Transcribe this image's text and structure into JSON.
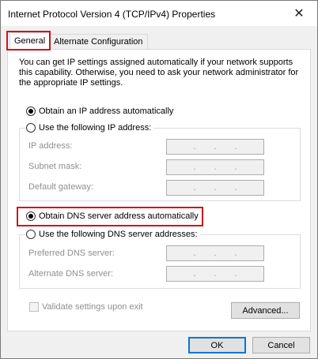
{
  "window": {
    "title": "Internet Protocol Version 4 (TCP/IPv4) Properties",
    "close_glyph": "✕"
  },
  "tabs": [
    {
      "label": "General",
      "active": true
    },
    {
      "label": "Alternate Configuration",
      "active": false
    }
  ],
  "general": {
    "description": "You can get IP settings assigned automatically if your network supports this capability. Otherwise, you need to ask your network administrator for the appropriate IP settings.",
    "ip_auto_label": "Obtain an IP address automatically",
    "ip_manual_label": "Use the following IP address:",
    "ip_mode": "auto",
    "ip_fields": [
      {
        "label": "IP address:",
        "value": ". . ."
      },
      {
        "label": "Subnet mask:",
        "value": ". . ."
      },
      {
        "label": "Default gateway:",
        "value": ". . ."
      }
    ],
    "dns_auto_label": "Obtain DNS server address automatically",
    "dns_manual_label": "Use the following DNS server addresses:",
    "dns_mode": "auto",
    "dns_fields": [
      {
        "label": "Preferred DNS server:",
        "value": ". . ."
      },
      {
        "label": "Alternate DNS server:",
        "value": ". . ."
      }
    ],
    "validate_label": "Validate settings upon exit",
    "validate_checked": false,
    "advanced_label": "Advanced..."
  },
  "footer": {
    "ok_label": "OK",
    "cancel_label": "Cancel"
  },
  "colors": {
    "highlight": "#d0121c",
    "focus_border": "#0078d7"
  }
}
